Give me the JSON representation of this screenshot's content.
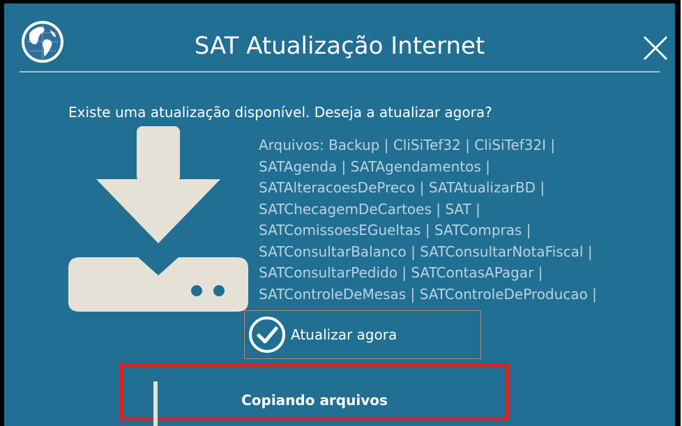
{
  "dialog": {
    "title": "SAT Atualização Internet",
    "globe_icon": "globe-icon",
    "close_icon": "close-icon"
  },
  "message": {
    "question": "Existe uma atualização disponível. Deseja a atualizar agora?",
    "download_icon": "download-icon",
    "files_lines": [
      "Arquivos: Backup | CliSiTef32 | CliSiTef32I |",
      "SATAgenda | SATAgendamentos |",
      "SATAlteracoesDePreco | SATAtualizarBD |",
      "SATChecagemDeCartoes | SAT |",
      "SATComissoesEGueltas | SATCompras |",
      "SATConsultarBalanco | SATConsultarNotaFiscal |",
      "SATConsultarPedido | SATContasAPagar |",
      "SATControleDeMesas | SATControleDeProducao |"
    ]
  },
  "actions": {
    "update_label": "Atualizar agora",
    "check_icon": "check-circle-icon"
  },
  "progress": {
    "label": "Copiando arquivos",
    "highlight_color": "#e02020"
  },
  "colors": {
    "dialog_bg": "#216f93",
    "file_text": "#bcd3e1",
    "icon_fill": "#e6e1d6"
  }
}
